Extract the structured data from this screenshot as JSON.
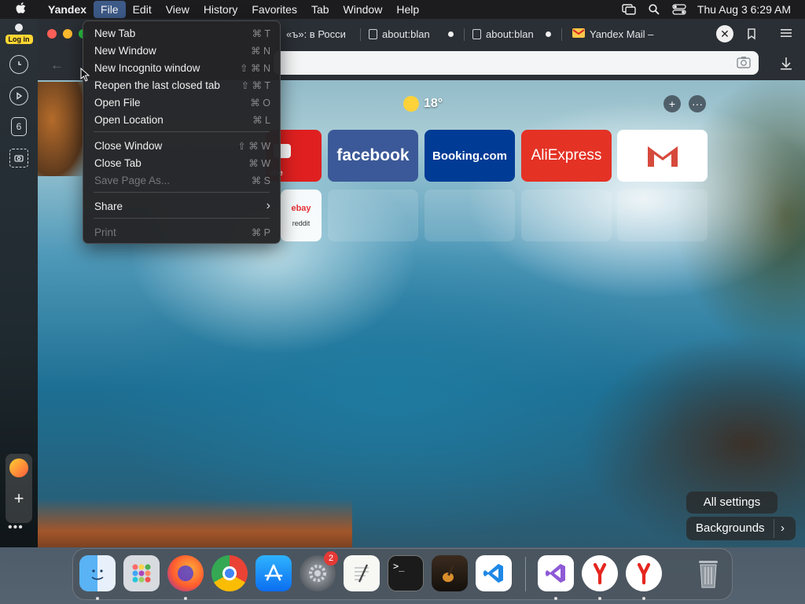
{
  "menubar": {
    "app": "Yandex",
    "items": [
      "File",
      "Edit",
      "View",
      "History",
      "Favorites",
      "Tab",
      "Window",
      "Help"
    ],
    "datetime": "Thu Aug 3  6:29 AM"
  },
  "sidebar": {
    "login_label": "Log in",
    "tab_count": "6"
  },
  "tabs": [
    {
      "label": "«ъ»: в Росси"
    },
    {
      "label": "about:blan"
    },
    {
      "label": "about:blan"
    },
    {
      "label": "Yandex Mail –"
    }
  ],
  "weather": {
    "temp": "18°"
  },
  "tiles": {
    "youtube": "ube",
    "facebook": "facebook",
    "booking": "Booking.com",
    "aliexpress": "AliExpress",
    "mini1": "ebay",
    "mini2": "reddit"
  },
  "file_menu": {
    "items": [
      {
        "label": "New Tab",
        "shortcut": "⌘ T"
      },
      {
        "label": "New Window",
        "shortcut": "⌘ N"
      },
      {
        "label": "New Incognito window",
        "shortcut": "⇧ ⌘ N"
      },
      {
        "label": "Reopen the last closed tab",
        "shortcut": "⇧ ⌘ T"
      },
      {
        "label": "Open File",
        "shortcut": "⌘ O"
      },
      {
        "label": "Open Location",
        "shortcut": "⌘ L"
      },
      {
        "label": "Close Window",
        "shortcut": "⇧ ⌘ W"
      },
      {
        "label": "Close Tab",
        "shortcut": "⌘ W"
      },
      {
        "label": "Save Page As...",
        "shortcut": "⌘ S"
      },
      {
        "label": "Share",
        "shortcut": "›"
      },
      {
        "label": "Print",
        "shortcut": "⌘ P"
      }
    ]
  },
  "bottom": {
    "all_settings": "All settings",
    "backgrounds": "Backgrounds"
  },
  "dock": {
    "settings_badge": "2",
    "apps": [
      "finder-icon",
      "launchpad-icon",
      "firefox-icon",
      "chrome-icon",
      "app-store-icon",
      "system-settings-icon",
      "textedit-icon",
      "terminal-icon",
      "garageband-icon",
      "vscode-icon",
      "visual-studio-icon",
      "yandex-browser-icon",
      "yandex-browser-icon",
      "trash-icon"
    ]
  },
  "colors": {
    "facebook": "#3b5998",
    "booking": "#003b95",
    "aliexpress": "#e43225",
    "youtube": "#e02020",
    "menu_highlight": "#3d5a88"
  }
}
